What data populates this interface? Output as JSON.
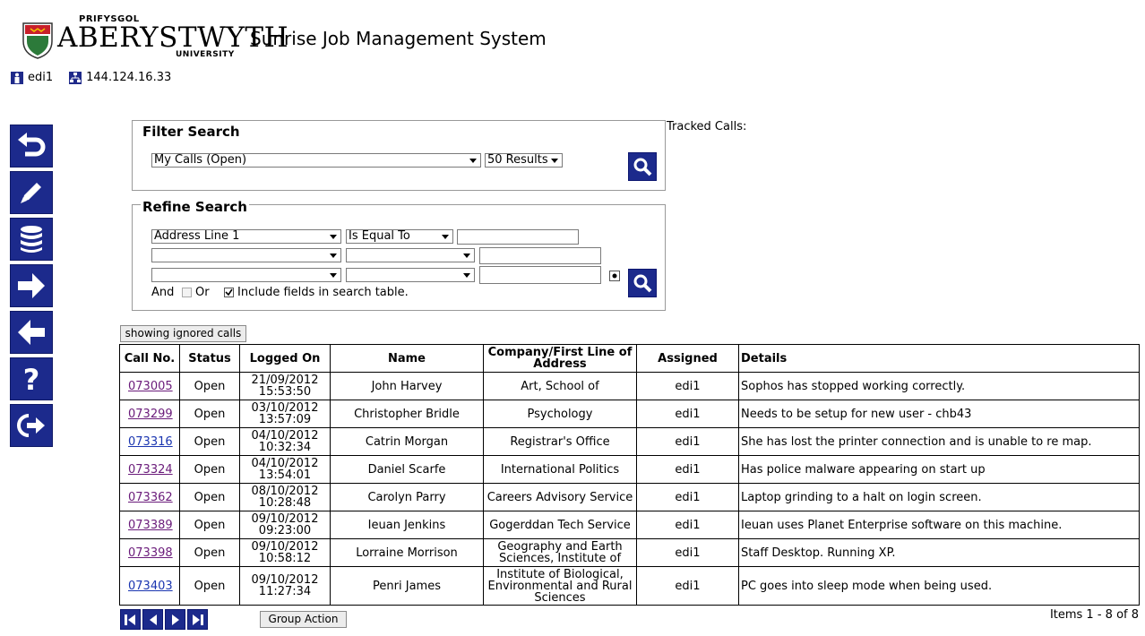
{
  "header": {
    "logo_prefix": "PRIFYSGOL",
    "logo_name": "ABERYSTWYTH",
    "logo_suffix": "UNIVERSITY",
    "app_title": "Sunrise Job Management System"
  },
  "session": {
    "user": "edi1",
    "ip": "144.124.16.33"
  },
  "nav": [
    {
      "name": "back-icon"
    },
    {
      "name": "edit-icon"
    },
    {
      "name": "database-icon"
    },
    {
      "name": "forward-arrow-icon"
    },
    {
      "name": "back-arrow-icon"
    },
    {
      "name": "help-icon"
    },
    {
      "name": "logout-icon"
    }
  ],
  "filter": {
    "legend": "Filter Search",
    "view_value": "My Calls (Open)",
    "results_value": "50 Results"
  },
  "tracked_label": "Tracked Calls:",
  "refine": {
    "legend": "Refine Search",
    "field1": "Address Line 1",
    "op1": "Is Equal To",
    "and_label": "And",
    "or_label": "Or",
    "include_label": "Include fields in search table."
  },
  "ignored_button": "showing ignored calls",
  "table": {
    "headers": [
      "Call No.",
      "Status",
      "Logged On",
      "Name",
      "Company/First Line of Address",
      "Assigned",
      "Details"
    ],
    "rows": [
      {
        "call": "073005",
        "status": "Open",
        "date": "21/09/2012",
        "time": "15:53:50",
        "name": "John Harvey",
        "company": "Art, School of",
        "assigned": "edi1",
        "details": "Sophos has stopped working correctly."
      },
      {
        "call": "073299",
        "status": "Open",
        "date": "03/10/2012",
        "time": "13:57:09",
        "name": "Christopher Bridle",
        "company": "Psychology",
        "assigned": "edi1",
        "details": "Needs to be setup for new user - chb43"
      },
      {
        "call": "073316",
        "status": "Open",
        "date": "04/10/2012",
        "time": "10:32:34",
        "name": "Catrin Morgan",
        "company": "Registrar's Office",
        "assigned": "edi1",
        "details": "She has lost the printer connection and is unable to re map."
      },
      {
        "call": "073324",
        "status": "Open",
        "date": "04/10/2012",
        "time": "13:54:01",
        "name": "Daniel Scarfe",
        "company": "International Politics",
        "assigned": "edi1",
        "details": "Has police malware appearing on start up"
      },
      {
        "call": "073362",
        "status": "Open",
        "date": "08/10/2012",
        "time": "10:28:48",
        "name": "Carolyn Parry",
        "company": "Careers Advisory Service",
        "assigned": "edi1",
        "details": "Laptop grinding to a halt on login screen."
      },
      {
        "call": "073389",
        "status": "Open",
        "date": "09/10/2012",
        "time": "09:23:00",
        "name": "Ieuan Jenkins",
        "company": "Gogerddan Tech Service",
        "assigned": "edi1",
        "details": "Ieuan uses Planet Enterprise software on this machine."
      },
      {
        "call": "073398",
        "status": "Open",
        "date": "09/10/2012",
        "time": "10:58:12",
        "name": "Lorraine Morrison",
        "company": "Geography and Earth Sciences, Institute of",
        "assigned": "edi1",
        "details": "Staff Desktop. Running XP."
      },
      {
        "call": "073403",
        "status": "Open",
        "date": "09/10/2012",
        "time": "11:27:34",
        "name": "Penri James",
        "company": "Institute of Biological, Environmental and Rural Sciences",
        "assigned": "edi1",
        "details": "PC goes into sleep mode when being used."
      }
    ]
  },
  "group_action": "Group Action",
  "items_text": "Items 1 - 8 of 8"
}
